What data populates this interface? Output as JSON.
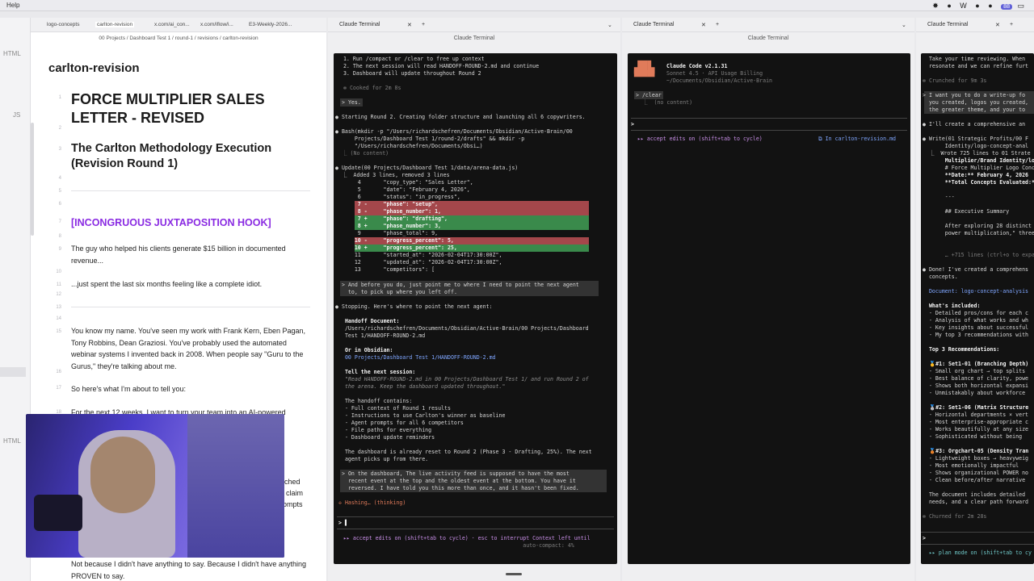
{
  "menubar": {
    "help": "Help",
    "tray_icons": "✸ ● W ● ●",
    "tray_pill": "88",
    "tray_end": "▭"
  },
  "rail": {
    "html_top": "HTML",
    "js": "JS",
    "html_bottom": "HTML"
  },
  "obsidian": {
    "tabs": [
      "logo-concepts",
      "carlton-revision",
      "x.com/ai_con...",
      "x.com/iflow/i...",
      "E3-Weekly-2026..."
    ],
    "breadcrumb": "00 Projects / Dashboard Test 1 / round-1 / revisions / carlton-revision",
    "title": "carlton-revision",
    "line_numbers": [
      "1",
      "2",
      "3",
      "4",
      "5",
      "6",
      "7",
      "8",
      "9",
      "10",
      "11",
      "12",
      "13",
      "14",
      "15",
      "16",
      "17",
      "18"
    ],
    "h1": "FORCE MULTIPLIER SALES LETTER - REVISED",
    "h2": "The Carlton Methodology Execution (Revision Round 1)",
    "hook": "[INCONGRUOUS JUXTAPOSITION HOOK]",
    "p1": "The guy who helped his clients generate $15 billion in documented revenue...",
    "p2": "...just spent the last six months feeling like a complete idiot.",
    "p3": "You know my name. You've seen my work with Frank Kern, Eben Pagan, Tony Robbins, Dean Graziosi. You've probably used the automated webinar systems I invented back in 2008. When people say \"Guru to the Gurus,\" they're talking about me.",
    "p4": "So here's what I'm about to tell you:",
    "p5": "For the next 12 weeks, I want to turn your team into an AI-powered",
    "frag1": "ched",
    "frag2": "claim",
    "frag3": "ompts",
    "p6": "Not because I didn't have anything to say. Because I didn't have anything PROVEN to say.",
    "foot": "⓪ ⚙"
  },
  "term1": {
    "tabs": [
      "Claude Terminal"
    ],
    "title": "Claude Terminal",
    "lines": {
      "l1": "  1. Run /compact or /clear to free up context",
      "l2": "  2. The next session will read HANDOFF-ROUND-2.md and continue",
      "l3": "  3. Dashboard will update throughout Round 2",
      "cooked": "✻ Cooked for 2m 8s",
      "user_yes": "> Yes.",
      "starting": "● Starting Round 2. Creating folder structure and launching all 6 copywriters.",
      "bash1": "● Bash(mkdir -p \"/Users/richardschefren/Documents/Obsidian/Active-Brain/00",
      "bash2": "      Projects/Dashboard Test 1/round-2/drafts\" && mkdir -p",
      "bash3": "      \"/Users/richardschefren/Documents/Obsi…)",
      "bash4": "  ⎿ (No content)",
      "upd1": "● Update(00 Projects/Dashboard Test 1/data/arena-data.js)",
      "upd2": "  ⎿  Added 3 lines, removed 3 lines",
      "d4": "       4       \"copy_type\": \"Sales Letter\",",
      "d5": "       5       \"date\": \"February 4, 2026\",",
      "d6": "       6       \"status\": \"in_progress\",",
      "d7m": "       7 -     \"phase\": \"setup\",",
      "d8m": "       8 -     \"phase_number\": 1,",
      "d7p": "       7 +     \"phase\": \"drafting\",",
      "d8p": "       8 +     \"phase_number\": 3,",
      "d9": "       9       \"phase_total\": 9,",
      "d10m": "      10 -     \"progress_percent\": 5,",
      "d10p": "      10 +     \"progress_percent\": 25,",
      "d11": "      11       \"started_at\": \"2026-02-04T17:30:00Z\",",
      "d12": "      12       \"updated_at\": \"2026-02-04T17:30:00Z\",",
      "d13": "      13       \"competitors\": [",
      "q1": "> And before you do, just point me to where I need to point the next agent",
      "q2": "  to, to pick up where you left off.",
      "stop": "● Stopping. Here's where to point the next agent:",
      "hd": "  Handoff Document:",
      "hp1": "  /Users/richardschefren/Documents/Obsidian/Active-Brain/00 Projects/Dashboard",
      "hp2": "  Test 1/HANDOFF-ROUND-2.md",
      "oi": "  Or in Obsidian:",
      "op": "  00 Projects/Dashboard Test 1/HANDOFF-ROUND-2.md",
      "tn": "  Tell the next session:",
      "tq1": "  \"Read HANDOFF-ROUND-2.md in 00 Projects/Dashboard Test 1/ and run Round 2 of",
      "tq2": "  the arena. Keep the dashboard updated throughout.\"",
      "hc": "  The handoff contains:",
      "b1": "  - Full context of Round 1 results",
      "b2": "  - Instructions to use Carlton's winner as baseline",
      "b3": "  - Agent prompts for all 6 competitors",
      "b4": "  - File paths for everything",
      "b5": "  - Dashboard update reminders",
      "da1": "  The dashboard is already reset to Round 2 (Phase 3 - Drafting, 25%). The next",
      "da2": "  agent picks up from there.",
      "od1": "> On the dashboard, The live activity feed is supposed to have the most",
      "od2": "  recent event at the top and the oldest event at the bottom. You have it",
      "od3": "  reversed. I have told you this more than once, and it hasn't been fixed.",
      "hashing": "✢ Hashing… (thinking)",
      "cursor": "> ▌",
      "acc1": "  ▸▸ accept edits on (shift+tab to cycle) · esc to interrupt Context left until",
      "acc2": "                                                          auto-compact: 4%"
    }
  },
  "term2": {
    "tabs": [
      "Claude Terminal"
    ],
    "title": "Claude Terminal",
    "lines": {
      "cc": "Claude Code v2.1.31",
      "sn": "Sonnet 4.5 · API Usage Billing",
      "path": "~/Documents/Obsidian/Active-Brain",
      "clear": "> /clear",
      "nc": "  ⎿  (no content)",
      "prompt": "> ",
      "acc": "  ▸▸ accept edits on (shift+tab to cycle)",
      "file": "⧉ In carlton-revision.md"
    }
  },
  "term3": {
    "tabs": [
      "Claude Terminal"
    ],
    "lines": {
      "r1": "  Take your time reviewing. When",
      "r2": "  resonate and we can refine furt",
      "r3": "✻ Crunched for 9m 3s",
      "r4": "> I want you to do a write-up fo",
      "r5": "  you created, logos you created,",
      "r6": "  the greater theme, and your to",
      "r7": "● I'll create a comprehensive an",
      "r8": "● Write(01 Strategic Profits/00 F",
      "r9": "       Identity/logo-concept-anal",
      "r10": "  ⎿  Wrote 725 lines to 01 Strate",
      "r11": "       Multiplier/Brand Identity/lo",
      "r12": "       # Force Multiplier Logo Conc",
      "r13": "       **Date:** February 4, 2026",
      "r14": "       **Total Concepts Evaluated:*",
      "r15": "       ---",
      "r16": "       ## Executive Summary",
      "r17": "       After exploring 28 distinct",
      "r18": "       power multiplication,\" three",
      "r19": "       … +715 lines (ctrl+o to expa",
      "r20": "● Done! I've created a comprehens",
      "r21": "  concepts.",
      "r22": "  Document: logo-concept-analysis",
      "r23": "  What's included:",
      "r24": "  - Detailed pros/cons for each c",
      "r25": "  - Analysis of what works and wh",
      "r26": "  - Key insights about successful",
      "r27": "  - My top 3 recommendations with",
      "r28": "  Top 3 Recommendations:",
      "r29": "  🥇#1: Set1-01 (Branching Depth)",
      "r30": "  - Small org chart → top splits",
      "r31": "  - Best balance of clarity, powe",
      "r32": "  - Shows both horizontal expansi",
      "r33": "  - Unmistakably about workforce",
      "r34": "  🥈#2: Set1-06 (Matrix Structure",
      "r35": "  - Horizontal departments × vert",
      "r36": "  - Most enterprise-appropriate c",
      "r37": "  - Works beautifully at any size",
      "r38": "  - Sophisticated without being",
      "r39": "  🥉#3: Orgchart-05 (Density Tran",
      "r40": "  - Lightweight boxes → heavyweig",
      "r41": "  - Most emotionally impactful",
      "r42": "  - Shows organizational POWER no",
      "r43": "  - Clean before/after narrative",
      "r44": "  The document includes detailed",
      "r45": "  needs, and a clear path forward",
      "r46": "✻ Churned for 2m 28s",
      "r47": "> ",
      "r48": "  ▸▸ plan mode on (shift+tab to cy"
    }
  }
}
